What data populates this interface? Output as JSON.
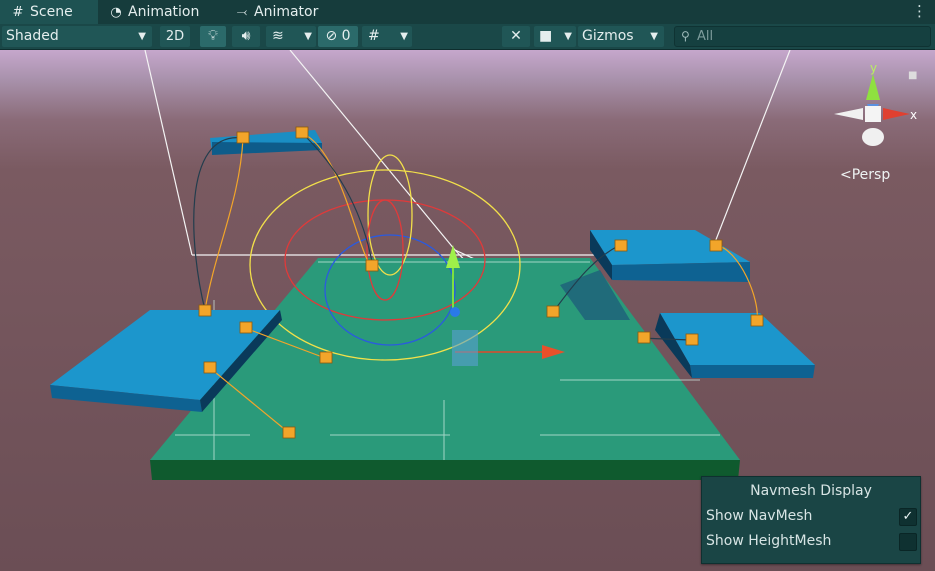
{
  "tabs": [
    {
      "label": "Scene",
      "icon": "#"
    },
    {
      "label": "Animation",
      "icon": "◔"
    },
    {
      "label": "Animator",
      "icon": "⤙"
    }
  ],
  "toolbar": {
    "shading_mode": "Shaded",
    "mode_2d": "2D",
    "hidden_count": "0",
    "gizmos_label": "Gizmos",
    "search_placeholder": "All"
  },
  "scene": {
    "camera_label": "Persp",
    "axis_labels": {
      "x": "x",
      "y": "y"
    }
  },
  "navmesh_display": {
    "title": "Navmesh Display",
    "options": [
      {
        "label": "Show NavMesh",
        "checked": true
      },
      {
        "label": "Show HeightMesh",
        "checked": false
      }
    ]
  },
  "colors": {
    "ground": "#2a9a7a",
    "platform": "#1a8ec4",
    "node": "#f2a52a",
    "sky_top": "#c6a7cc",
    "horizon": "#7a5a61"
  }
}
